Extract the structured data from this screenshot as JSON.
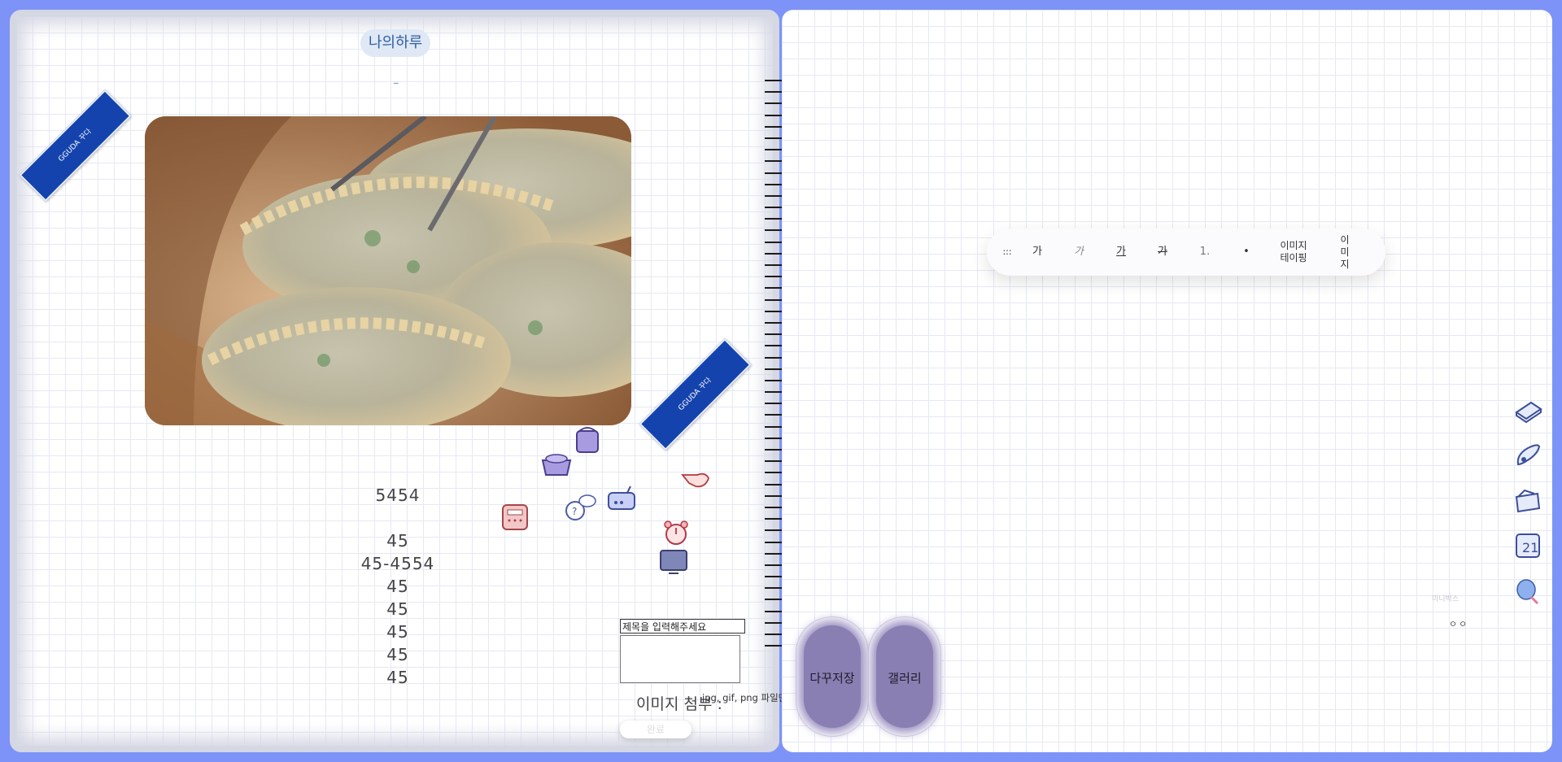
{
  "diary": {
    "title": "나의하루",
    "subtitle": "_",
    "numbers": [
      "5454",
      "",
      "45",
      "45-4554",
      "45",
      "45",
      "45",
      "45",
      "45"
    ]
  },
  "tapes": [
    {
      "label": "GGUDA 꾸다"
    },
    {
      "label": "GGUDA 꾸다"
    }
  ],
  "form": {
    "title_placeholder": "제목을 입력해주세요",
    "attach_label": "이미지 첨부 :",
    "file_hint": "jpg, gif, png 파일만",
    "ghost_button": "완료"
  },
  "toolbar": {
    "items": [
      {
        "label": ":::",
        "name": "drag-handle"
      },
      {
        "label": "가",
        "name": "bold-button"
      },
      {
        "label": "가",
        "name": "italic-button"
      },
      {
        "label": "가",
        "name": "underline-button"
      },
      {
        "label": "가",
        "name": "strike-button"
      },
      {
        "label": "1.",
        "name": "ordered-list-button"
      },
      {
        "label": "•",
        "name": "bullet-list-button"
      },
      {
        "label": "이미지\n테이핑",
        "name": "image-taping-button"
      },
      {
        "label": "이\n미\n지",
        "name": "image-button"
      }
    ]
  },
  "bottom_buttons": {
    "save": "다꾸저장",
    "gallery": "갤러리"
  },
  "side_tools": [
    "memo-pad-icon",
    "brush-icon",
    "wallet-icon",
    "calendar-icon",
    "pin-icon"
  ],
  "misc": {
    "label": "미니박스",
    "value": "ㅇㅇ"
  },
  "colors": {
    "frame": "#7d93f7",
    "tape": "#1443ad",
    "button_fill": "#8a7fb3"
  }
}
